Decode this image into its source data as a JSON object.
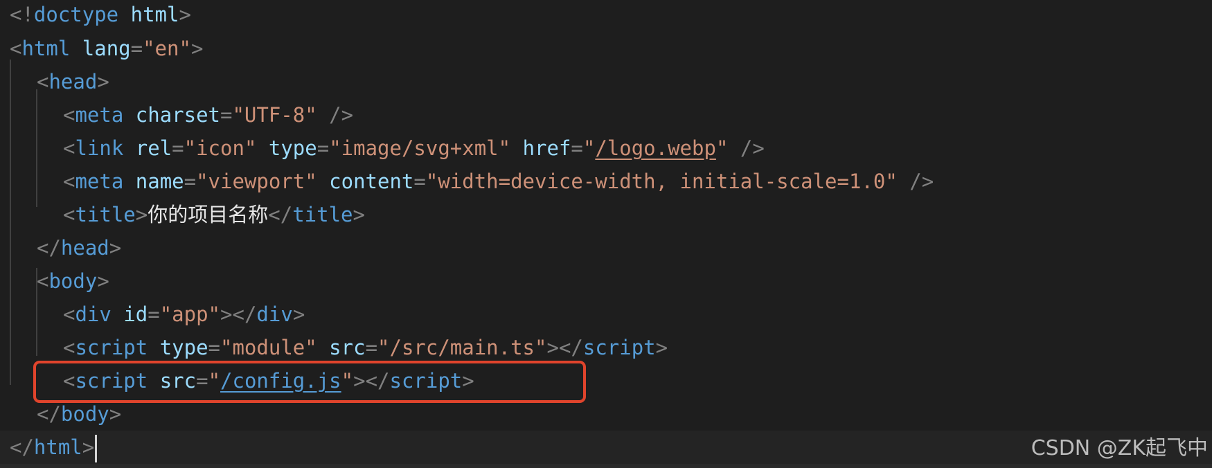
{
  "code": {
    "l1": {
      "open": "<!",
      "kw": "doctype",
      "sp": " ",
      "name": "html",
      "close": ">"
    },
    "l2": {
      "open": "<",
      "tag": "html",
      "sp": " ",
      "attr": "lang",
      "eq": "=",
      "val": "\"en\"",
      "close": ">"
    },
    "l3": {
      "open": "<",
      "tag": "head",
      "close": ">"
    },
    "l4": {
      "open": "<",
      "tag": "meta",
      "sp": " ",
      "attr": "charset",
      "eq": "=",
      "val": "\"UTF-8\"",
      "selfclose": " />"
    },
    "l5": {
      "open": "<",
      "tag": "link",
      "sp1": " ",
      "a1": "rel",
      "eq1": "=",
      "v1": "\"icon\"",
      "sp2": " ",
      "a2": "type",
      "eq2": "=",
      "v2": "\"image/svg+xml\"",
      "sp3": " ",
      "a3": "href",
      "eq3": "=",
      "q1": "\"",
      "link": "/logo.webp",
      "q2": "\"",
      "selfclose": " />"
    },
    "l6": {
      "open": "<",
      "tag": "meta",
      "sp1": " ",
      "a1": "name",
      "eq1": "=",
      "v1": "\"viewport\"",
      "sp2": " ",
      "a2": "content",
      "eq2": "=",
      "v2": "\"width=device-width, initial-scale=1.0\"",
      "selfclose": " />"
    },
    "l7": {
      "open": "<",
      "tag": "title",
      "close": ">",
      "text": "你的项目名称",
      "endopen": "</",
      "endtag": "title",
      "endclose": ">"
    },
    "l8": {
      "open": "</",
      "tag": "head",
      "close": ">"
    },
    "l9": {
      "open": "<",
      "tag": "body",
      "close": ">"
    },
    "l10": {
      "open": "<",
      "tag": "div",
      "sp": " ",
      "attr": "id",
      "eq": "=",
      "val": "\"app\"",
      "close": ">",
      "endopen": "</",
      "endtag": "div",
      "endclose": ">"
    },
    "l11": {
      "open": "<",
      "tag": "script",
      "sp1": " ",
      "a1": "type",
      "eq1": "=",
      "v1": "\"module\"",
      "sp2": " ",
      "a2": "src",
      "eq2": "=",
      "v2": "\"/src/main.ts\"",
      "close": ">",
      "endopen": "</",
      "endtag": "script",
      "endclose": ">"
    },
    "l12": {
      "open": "<",
      "tag": "script",
      "sp": " ",
      "attr": "src",
      "eq": "=",
      "q1": "\"",
      "link": "/config.js",
      "q2": "\"",
      "close": ">",
      "endopen": "</",
      "endtag": "script",
      "endclose": ">"
    },
    "l13": {
      "open": "</",
      "tag": "body",
      "close": ">"
    },
    "l14": {
      "open": "</",
      "tag": "html",
      "close": ">"
    }
  },
  "watermark": "CSDN @ZK起飞中",
  "colors": {
    "background": "#1e1e1e",
    "tag": "#569cd6",
    "attribute": "#9cdcfe",
    "string": "#ce9178",
    "punctuation": "#808080",
    "highlight_box": "#e0442c"
  }
}
